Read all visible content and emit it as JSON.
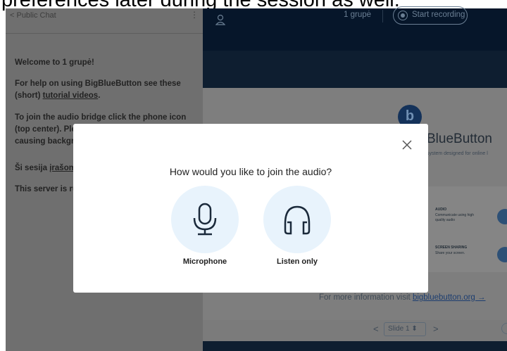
{
  "caption": {
    "text": "preferences later during the session as well."
  },
  "chat": {
    "header": {
      "back_label": "< Public Chat",
      "menu_glyph": "⋮"
    },
    "messages": [
      {
        "id": "welcome",
        "text": "Welcome to 1 grupė!"
      },
      {
        "id": "help",
        "text_before": "For help on using BigBlueButton see these (short) ",
        "link": "tutorial videos",
        "text_after": "."
      },
      {
        "id": "audio",
        "text": "To join the audio bridge click the phone icon (top center). Please u",
        "text_bold_tail": "se a headset to avoid causing background noi"
      },
      {
        "id": "recording",
        "text_before": "Ši sesija ",
        "link": "įrašoma"
      },
      {
        "id": "server",
        "text": "This server is ru"
      }
    ]
  },
  "presentation": {
    "meeting_name": "1 grupė",
    "record_label": "Start recording",
    "slide": {
      "logo_letter": "b",
      "title": "BlueButton",
      "subtitle": "system designed for online l",
      "features": [
        {
          "title": "AUDIO",
          "text": "Communicate using high quality audio"
        },
        {
          "title": "SCREEN SHARING",
          "text": "Share your screen."
        }
      ],
      "more_info_text": "For more information visit ",
      "more_info_link": "bigbluebutton.org →"
    },
    "nav": {
      "prev": "<",
      "slide_select": "Slide 1 ⬍",
      "next": ">"
    }
  },
  "modal": {
    "title": "How would you like to join the audio?",
    "options": [
      {
        "id": "microphone",
        "label": "Microphone",
        "icon": "microphone-icon"
      },
      {
        "id": "listen",
        "label": "Listen only",
        "icon": "headphones-icon"
      }
    ],
    "close_icon": "close-icon"
  },
  "colors": {
    "accent_light": "#e8f3fc",
    "icon_stroke": "#1b2a3b",
    "dark_bg": "#06172a"
  }
}
